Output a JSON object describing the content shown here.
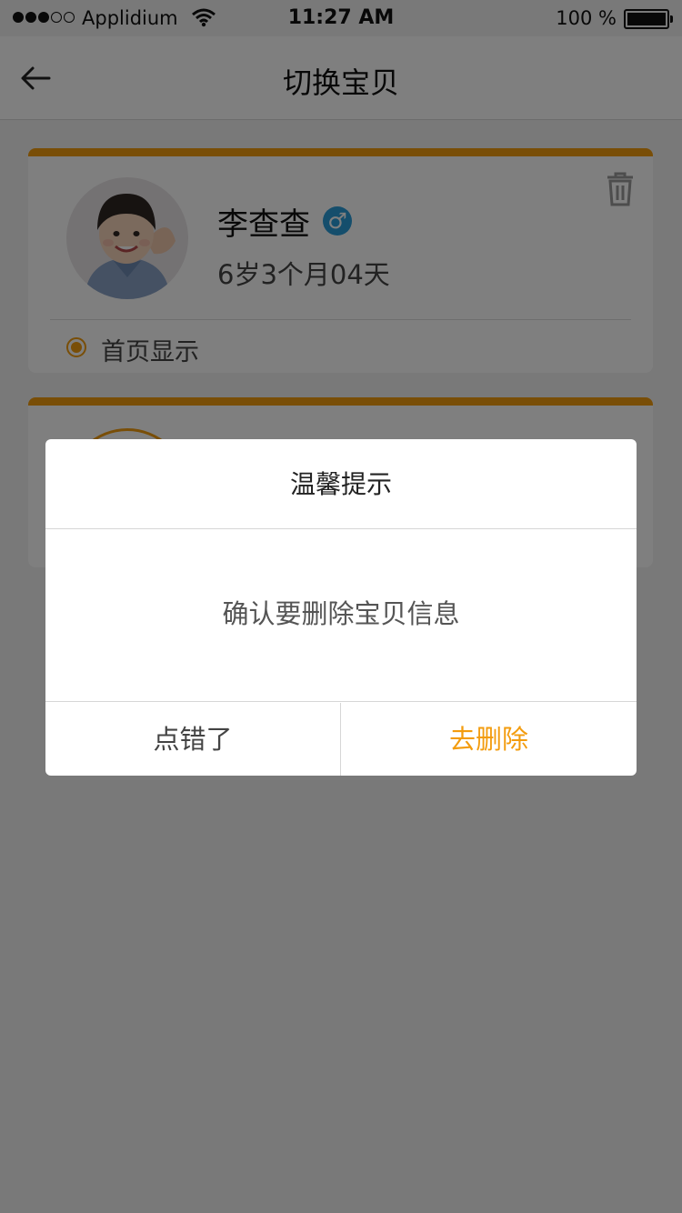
{
  "status_bar": {
    "carrier": "Applidium",
    "time": "11:27 AM",
    "battery": "100 %"
  },
  "nav": {
    "title": "切换宝贝",
    "back_icon": "back-arrow-icon"
  },
  "babies": [
    {
      "name": "李查查",
      "gender_icon": "male-icon",
      "gender_symbol": "♂",
      "age": "6岁3个月04天",
      "home_display_label": "首页显示",
      "home_display_selected": true
    }
  ],
  "dialog": {
    "title": "温馨提示",
    "message": "确认要删除宝贝信息",
    "cancel_label": "点错了",
    "confirm_label": "去删除"
  },
  "colors": {
    "accent": "#f39c0e",
    "gender_male": "#2a9cd8",
    "overlay": "rgba(0,0,0,0.5)"
  }
}
